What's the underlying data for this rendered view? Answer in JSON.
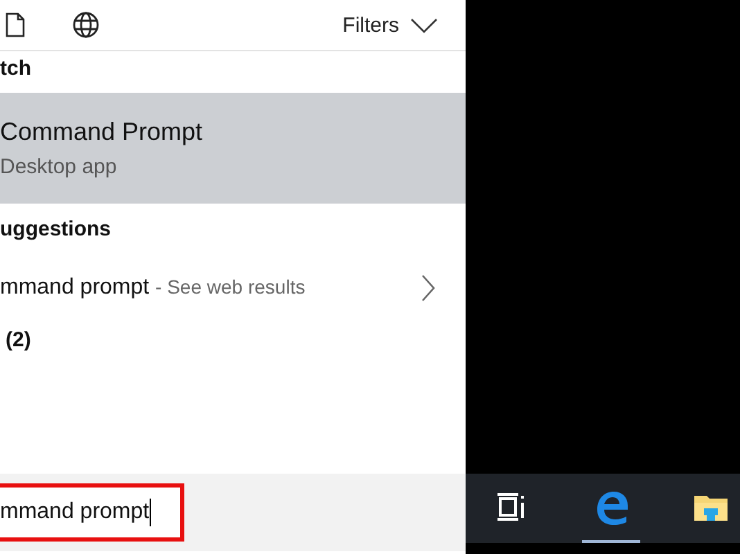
{
  "toolbar": {
    "filters_label": "Filters"
  },
  "best_match": {
    "heading": "tch",
    "item": {
      "title": "Command Prompt",
      "subtitle": "Desktop app",
      "selected": true
    }
  },
  "suggestions": {
    "heading": "uggestions",
    "item": {
      "query": "mmand prompt",
      "hint": "- See web results"
    }
  },
  "section_3": {
    "heading": "(2)"
  },
  "search": {
    "value": "mmand prompt",
    "highlighted": true
  },
  "taskbar": {
    "items": [
      {
        "kind": "taskview",
        "selected": false
      },
      {
        "kind": "edge",
        "selected": true
      },
      {
        "kind": "folder",
        "selected": false
      }
    ]
  }
}
